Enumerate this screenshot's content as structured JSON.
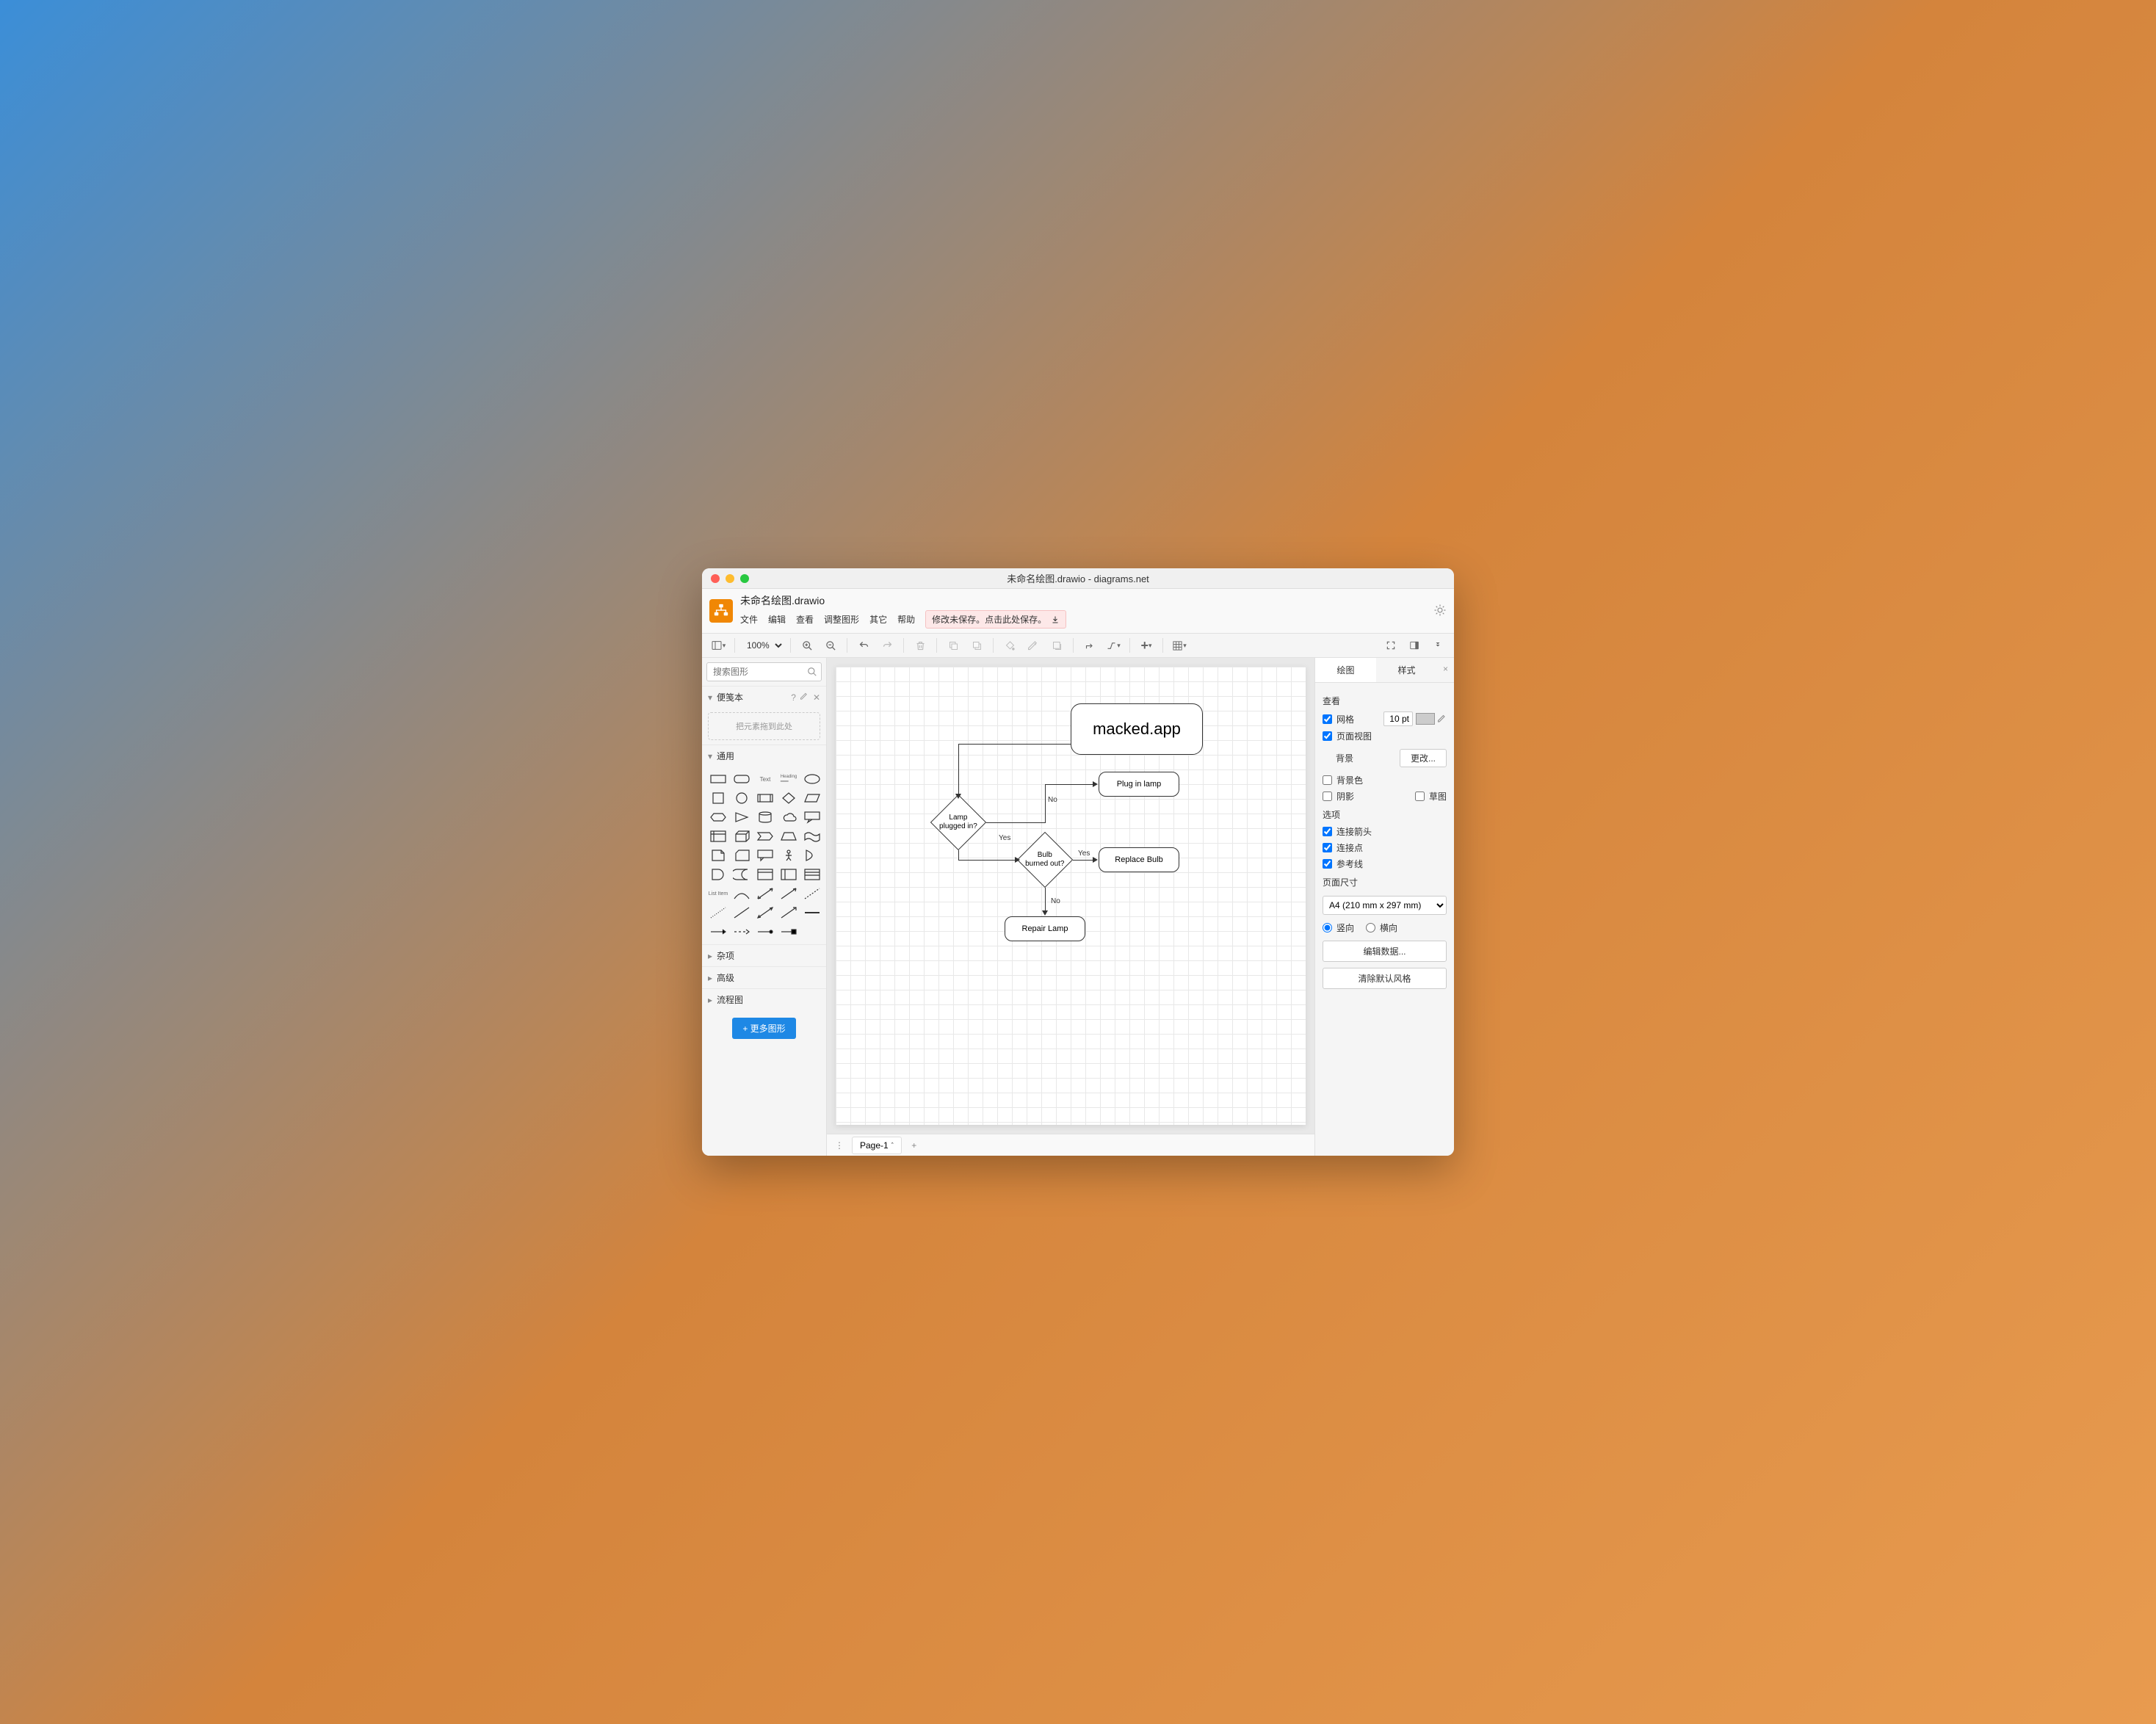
{
  "window_title": "未命名绘图.drawio - diagrams.net",
  "file_title": "未命名绘图.drawio",
  "menu": {
    "file": "文件",
    "edit": "编辑",
    "view": "查看",
    "arrange": "调整图形",
    "extras": "其它",
    "help": "帮助"
  },
  "save_warning": "修改未保存。点击此处保存。",
  "zoom_value": "100%",
  "sidebar": {
    "search_placeholder": "搜索图形",
    "scratchpad": {
      "title": "便笺本",
      "drop_hint": "把元素拖到此处"
    },
    "general_title": "通用",
    "misc_title": "杂项",
    "advanced_title": "高级",
    "flowchart_title": "流程图",
    "more_shapes": "+ 更多图形"
  },
  "flowchart": {
    "title_node": "macked.app",
    "decision1": "Lamp\nplugged in?",
    "decision2": "Bulb\nburned out?",
    "action1": "Plug in lamp",
    "action2": "Replace Bulb",
    "action3": "Repair Lamp",
    "label_no": "No",
    "label_yes": "Yes"
  },
  "page_tab": "Page-1",
  "right_panel": {
    "tab_diagram": "绘图",
    "tab_style": "样式",
    "view_title": "查看",
    "grid": "网格",
    "grid_size": "10 pt",
    "page_view": "页面视图",
    "background": "背景",
    "change": "更改...",
    "bg_color": "背景色",
    "shadow": "阴影",
    "sketch": "草图",
    "options_title": "选项",
    "connection_arrows": "连接箭头",
    "connection_points": "连接点",
    "guides": "参考线",
    "page_size_title": "页面尺寸",
    "page_size_value": "A4 (210 mm x 297 mm)",
    "portrait": "竖向",
    "landscape": "横向",
    "edit_data": "编辑数据...",
    "clear_style": "清除默认风格"
  }
}
